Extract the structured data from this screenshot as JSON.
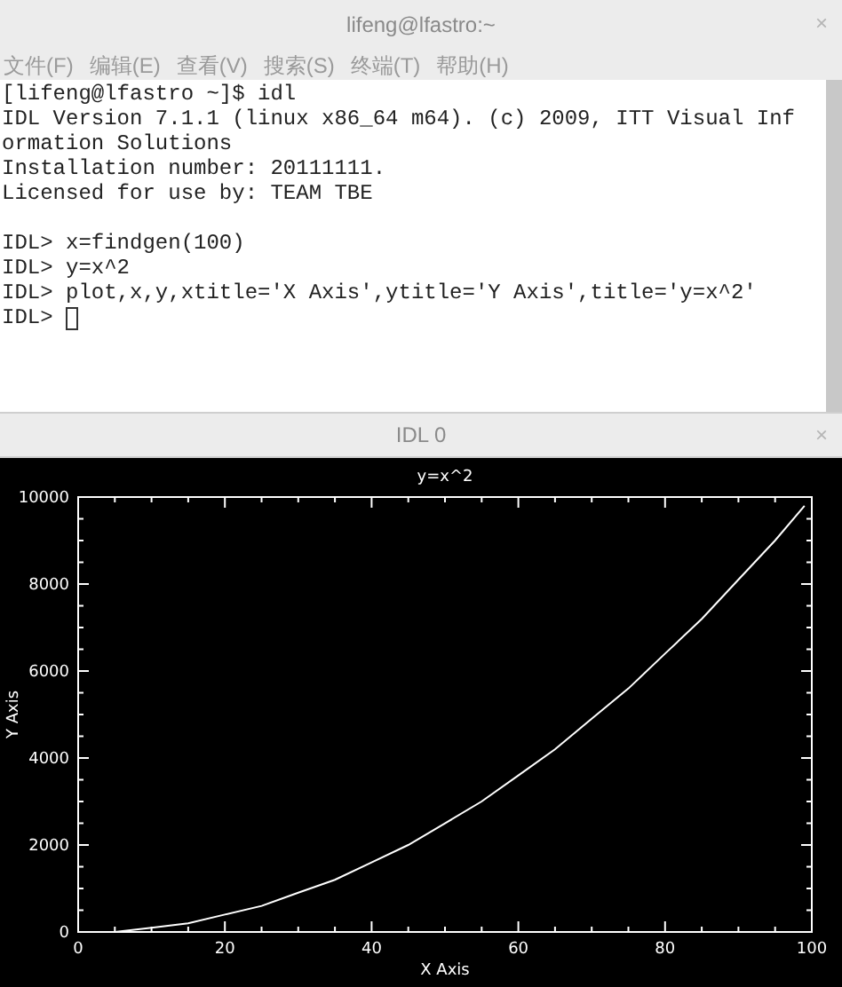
{
  "terminal_window": {
    "title": "lifeng@lfastro:~",
    "close": "×",
    "menu": [
      "文件(F)",
      "编辑(E)",
      "查看(V)",
      "搜索(S)",
      "终端(T)",
      "帮助(H)"
    ],
    "blocks": [
      [
        "[lifeng@lfastro ~]$ idl",
        "IDL Version 7.1.1 (linux x86_64 m64). (c) 2009, ITT Visual Inf",
        "ormation Solutions",
        "Installation number: 20111111.",
        "Licensed for use by: TEAM TBE"
      ],
      [
        "IDL> x=findgen(100)",
        "IDL> y=x^2",
        "IDL> plot,x,y,xtitle='X Axis',ytitle='Y Axis',title='y=x^2'"
      ]
    ],
    "input_line": {
      "prompt": "IDL>",
      "cursor": true
    }
  },
  "plot_window": {
    "title": "IDL 0",
    "close": "×",
    "chart_data": {
      "type": "line",
      "title": "y=x^2",
      "xlabel": "X Axis",
      "ylabel": "Y Axis",
      "xlim": [
        0,
        100
      ],
      "ylim": [
        0,
        10000
      ],
      "xticks": [
        0,
        20,
        40,
        60,
        80,
        100
      ],
      "yticks": [
        0,
        2000,
        4000,
        6000,
        8000,
        10000
      ],
      "x": [
        0,
        5,
        10,
        15,
        20,
        25,
        30,
        35,
        40,
        45,
        50,
        55,
        60,
        65,
        70,
        75,
        80,
        85,
        90,
        95,
        99
      ],
      "series": [
        {
          "color": "#ffffff",
          "values": [
            0,
            0,
            100,
            200,
            400,
            600,
            900,
            1200,
            1600,
            2000,
            2500,
            3000,
            3600,
            4200,
            4900,
            5600,
            6400,
            7200,
            8100,
            9000,
            9800
          ]
        }
      ]
    }
  }
}
